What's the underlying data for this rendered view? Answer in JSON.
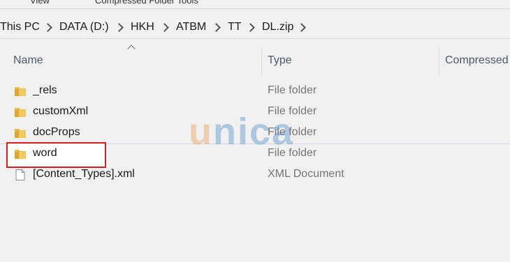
{
  "ribbon": {
    "items": [
      "View",
      "Compressed Folder Tools"
    ]
  },
  "breadcrumb": [
    "This PC",
    "DATA (D:)",
    "HKH",
    "ATBM",
    "TT",
    "DL.zip"
  ],
  "columns": {
    "name": "Name",
    "type": "Type",
    "compressed": "Compressed"
  },
  "files": [
    {
      "name": "_rels",
      "type": "File folder",
      "icon": "folder-icon"
    },
    {
      "name": "customXml",
      "type": "File folder",
      "icon": "folder-icon"
    },
    {
      "name": "docProps",
      "type": "File folder",
      "icon": "folder-icon"
    },
    {
      "name": "word",
      "type": "File folder",
      "icon": "folder-icon",
      "highlighted": true
    },
    {
      "name": "[Content_Types].xml",
      "type": "XML Document",
      "icon": "document-icon"
    }
  ],
  "watermark": {
    "text_u": "u",
    "text_rest": "nica"
  },
  "colors": {
    "highlight": "#d41f1f",
    "folder": "#e8b84a",
    "type_text": "#767676"
  }
}
